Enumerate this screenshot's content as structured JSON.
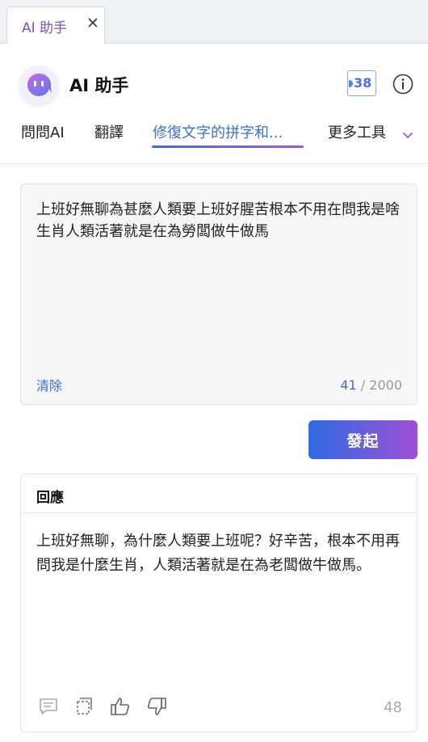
{
  "tab": {
    "title": "AI 助手",
    "close": "✕"
  },
  "header": {
    "title": "AI 助手",
    "credits": "38",
    "logo_icon": "robot-face-icon",
    "info_icon": "info-icon"
  },
  "nav": {
    "items": [
      {
        "label": "問問AI"
      },
      {
        "label": "翻譯"
      },
      {
        "label": "修復文字的拼字和..."
      },
      {
        "label": "更多工具"
      }
    ],
    "active_index": 2
  },
  "input": {
    "text": "上班好無聊為甚麼人類要上班好腥苦根本不用在問我是啥生肖人類活著就是在為勞闆做牛做馬",
    "clear_label": "清除",
    "used": "41",
    "max": "/ 2000"
  },
  "send_label": "發起",
  "response": {
    "title": "回應",
    "text": "上班好無聊，為什麼人類要上班呢？好辛苦，根本不用再問我是什麼生肖，人類活著就是在為老闆做牛做馬。",
    "count": "48",
    "icons": [
      "comment-icon",
      "copy-icon",
      "thumbs-up-icon",
      "thumbs-down-icon"
    ]
  },
  "colors": {
    "accent": "#3b6fd4",
    "accent2": "#9d4fd8",
    "brand_purple": "#7b4fd6"
  }
}
